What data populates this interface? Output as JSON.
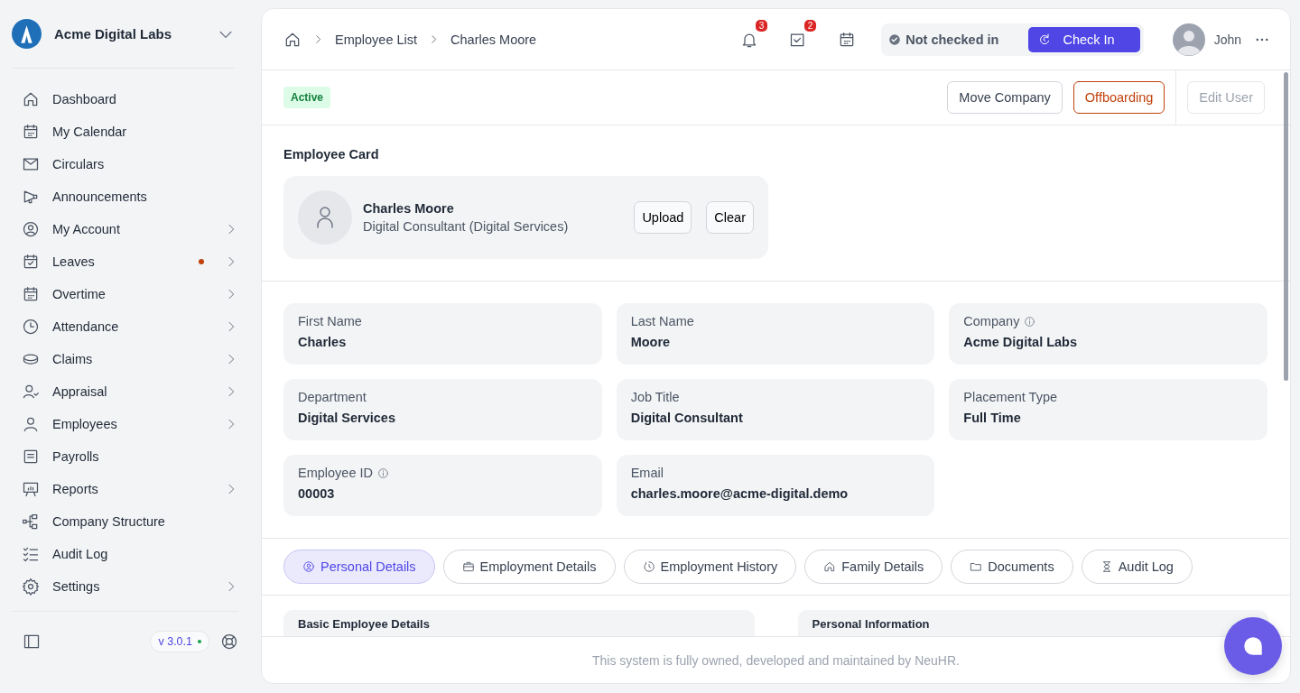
{
  "sidebar": {
    "company": "Acme Digital Labs",
    "items": [
      {
        "label": "Dashboard",
        "has_submenu": false,
        "has_dot": false
      },
      {
        "label": "My Calendar",
        "has_submenu": false,
        "has_dot": false
      },
      {
        "label": "Circulars",
        "has_submenu": false,
        "has_dot": false
      },
      {
        "label": "Announcements",
        "has_submenu": false,
        "has_dot": false
      },
      {
        "label": "My Account",
        "has_submenu": true,
        "has_dot": false
      },
      {
        "label": "Leaves",
        "has_submenu": true,
        "has_dot": true
      },
      {
        "label": "Overtime",
        "has_submenu": true,
        "has_dot": false
      },
      {
        "label": "Attendance",
        "has_submenu": true,
        "has_dot": false
      },
      {
        "label": "Claims",
        "has_submenu": true,
        "has_dot": false
      },
      {
        "label": "Appraisal",
        "has_submenu": true,
        "has_dot": false
      },
      {
        "label": "Employees",
        "has_submenu": true,
        "has_dot": false
      },
      {
        "label": "Payrolls",
        "has_submenu": false,
        "has_dot": false
      },
      {
        "label": "Reports",
        "has_submenu": true,
        "has_dot": false
      },
      {
        "label": "Company Structure",
        "has_submenu": false,
        "has_dot": false
      },
      {
        "label": "Audit Log",
        "has_submenu": false,
        "has_dot": false
      },
      {
        "label": "Settings",
        "has_submenu": true,
        "has_dot": false
      }
    ],
    "version": "v 3.0.1"
  },
  "header": {
    "breadcrumbs": [
      "Employee List",
      "Charles Moore"
    ],
    "notification_count": "3",
    "task_count": "2",
    "check_status": "Not checked in",
    "check_in_button": "Check In",
    "user_name": "John"
  },
  "status_badge": "Active",
  "actions": [
    {
      "label": "Move Company",
      "kind": "default"
    },
    {
      "label": "Offboarding",
      "kind": "danger"
    },
    {
      "label": "Edit User",
      "kind": "disabled"
    }
  ],
  "employee_card": {
    "title": "Employee Card",
    "name": "Charles Moore",
    "subtitle": "Digital Consultant (Digital Services)",
    "buttons": [
      "Upload",
      "Clear"
    ]
  },
  "fields": [
    {
      "label": "First Name",
      "value": "Charles",
      "info": false
    },
    {
      "label": "Last Name",
      "value": "Moore",
      "info": false
    },
    {
      "label": "Company",
      "value": "Acme Digital Labs",
      "info": true
    },
    {
      "label": "Department",
      "value": "Digital Services",
      "info": false
    },
    {
      "label": "Job Title",
      "value": "Digital Consultant",
      "info": false
    },
    {
      "label": "Placement Type",
      "value": "Full Time",
      "info": false
    },
    {
      "label": "Employee ID",
      "value": "00003",
      "info": true
    },
    {
      "label": "Email",
      "value": "charles.moore@acme-digital.demo",
      "info": false
    }
  ],
  "tabs": [
    {
      "label": "Personal Details",
      "selected": true
    },
    {
      "label": "Employment Details",
      "selected": false
    },
    {
      "label": "Employment History",
      "selected": false
    },
    {
      "label": "Family Details",
      "selected": false
    },
    {
      "label": "Documents",
      "selected": false
    },
    {
      "label": "Audit Log",
      "selected": false
    }
  ],
  "sections": [
    {
      "title": "Basic Employee Details"
    },
    {
      "title": "Personal Information"
    }
  ],
  "footer": "This system is fully owned, developed and maintained by NeuHR."
}
